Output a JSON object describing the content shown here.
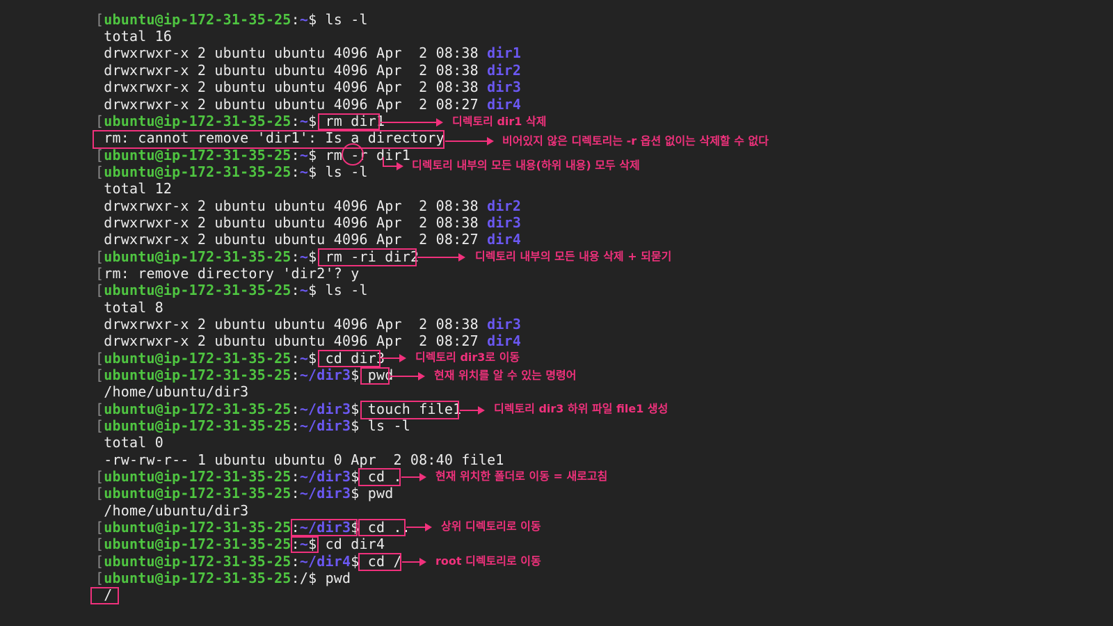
{
  "prompt": {
    "bracket": "[",
    "user": "ubuntu@ip-172-31-35-25",
    "colon": ":",
    "home": "~",
    "dir3": "~/dir3",
    "dir4": "~/dir4",
    "root": "/",
    "sign": "$"
  },
  "cmd": {
    "ls": "ls -l",
    "rm_dir1": "rm dir1",
    "rm_r_pre": "rm ",
    "rm_r_flag": "-r",
    "rm_r_post": " dir1",
    "rm_ri": "rm -ri dir2",
    "cd_dir3": "cd dir3",
    "pwd": "pwd",
    "touch": "touch file1",
    "cd_dot": "cd .",
    "cd_up": "cd ..",
    "cd_dir4": "cd dir4",
    "cd_root": "cd /"
  },
  "out": {
    "total16": "total 16",
    "total12": "total 12",
    "total8": "total 8",
    "total0": "total 0",
    "perm_a": "drwxrwxr-x 2 ubuntu ubuntu 4096 Apr  2 08:38 ",
    "perm_b": "drwxrwxr-x 2 ubuntu ubuntu 4096 Apr  2 08:27 ",
    "file_row": "-rw-rw-r-- 1 ubuntu ubuntu 0 Apr  2 08:40 file1",
    "dir1": "dir1",
    "dir2": "dir2",
    "dir3": "dir3",
    "dir4": "dir4",
    "rm_err": "rm: cannot remove 'dir1': Is a directory",
    "rm_prompt": "rm: remove directory 'dir2'? y",
    "pwd_dir3": "/home/ubuntu/dir3",
    "pwd_root": "/"
  },
  "annotations": {
    "a1": "디렉토리 dir1 삭제",
    "a2": "비어있지 않은 디렉토리는 -r 옵션 없이는 삭제할 수 없다",
    "a3": "디렉토리 내부의 모든 내용(하위 내용) 모두 삭제",
    "a4": "디렉토리 내부의 모든 내용 삭제 + 되묻기",
    "a5": "디렉토리 dir3로 이동",
    "a6": "현재 위치를 알 수 있는 명령어",
    "a7": "디렉토리 dir3 하위 파일 file1 생성",
    "a8": "현재 위치한 폴더로 이동 = 새로고침",
    "a9": "상위 디렉토리로 이동",
    "a10": "root 디렉토리로 이동"
  },
  "colors": {
    "background": "#232323",
    "user": "#4fc541",
    "path": "#6b58f2",
    "annotation": "#f0317c",
    "text": "#ececec"
  }
}
